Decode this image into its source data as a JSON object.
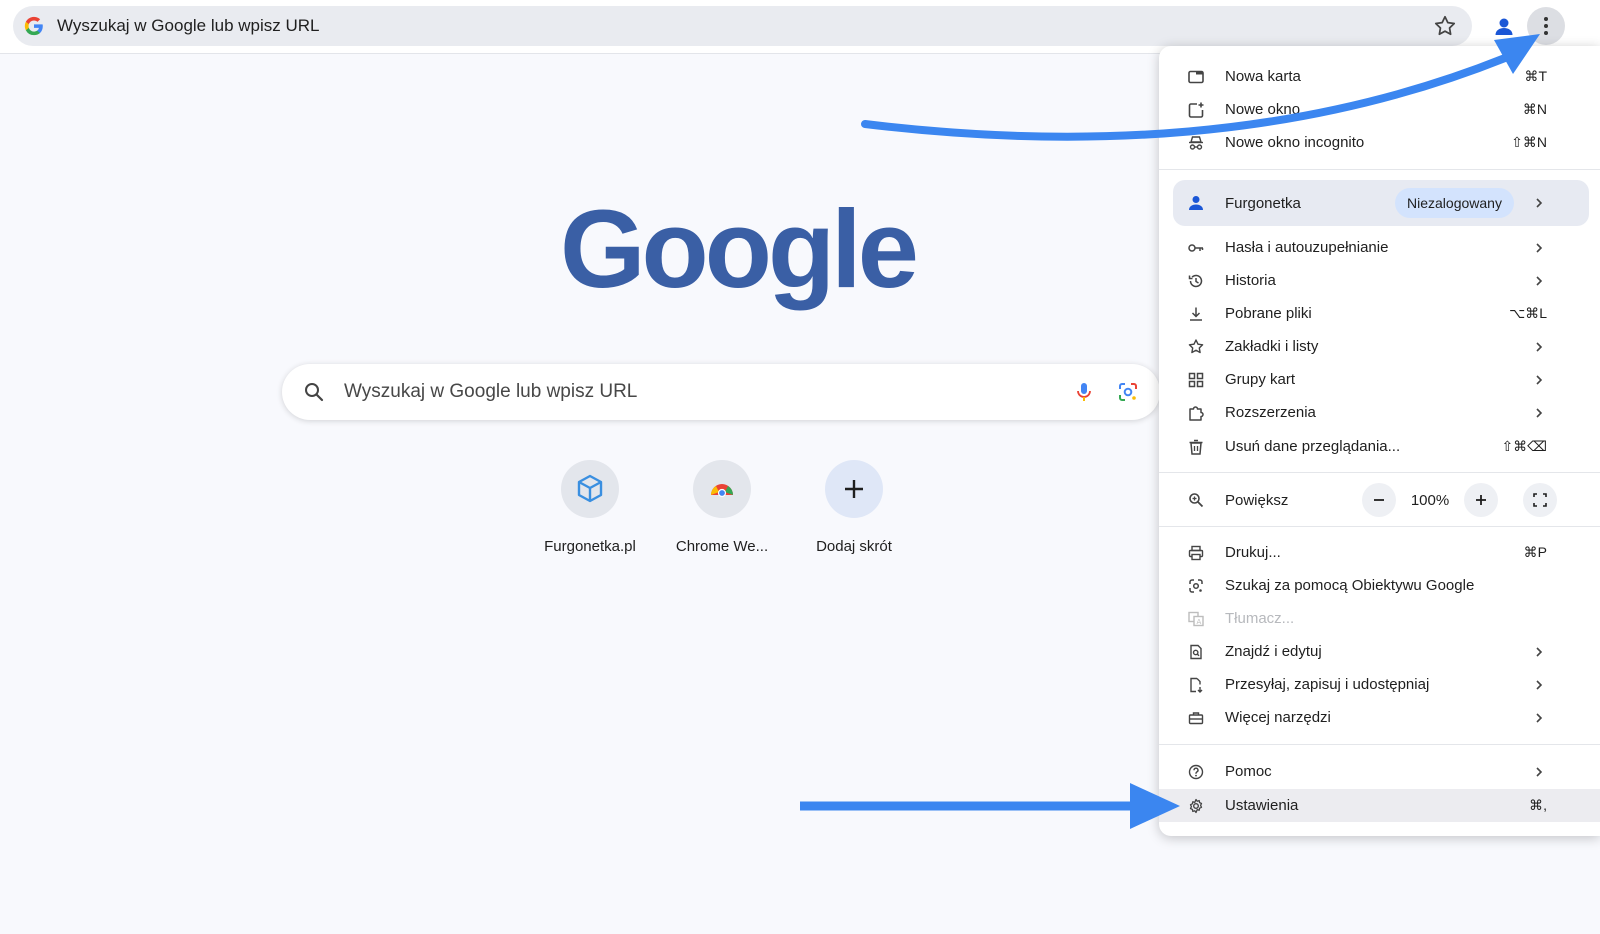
{
  "toolbar": {
    "omnibox_text": "Wyszukaj w Google lub wpisz URL"
  },
  "logo_text": "Google",
  "search": {
    "placeholder": "Wyszukaj w Google lub wpisz URL"
  },
  "shortcuts": [
    {
      "label": "Furgonetka.pl",
      "icon": "box-icon"
    },
    {
      "label": "Chrome We...",
      "icon": "chrome-icon"
    },
    {
      "label": "Dodaj skrót",
      "icon": "plus-icon"
    }
  ],
  "menu": {
    "new_tab": {
      "label": "Nowa karta",
      "shortcut": "⌘T"
    },
    "new_window": {
      "label": "Nowe okno",
      "shortcut": "⌘N"
    },
    "incognito": {
      "label": "Nowe okno incognito",
      "shortcut": "⇧⌘N"
    },
    "profile": {
      "label": "Furgonetka",
      "status": "Niezalogowany"
    },
    "passwords": {
      "label": "Hasła i autouzupełnianie"
    },
    "history": {
      "label": "Historia"
    },
    "downloads": {
      "label": "Pobrane pliki",
      "shortcut": "⌥⌘L"
    },
    "bookmarks": {
      "label": "Zakładki i listy"
    },
    "tab_groups": {
      "label": "Grupy kart"
    },
    "extensions": {
      "label": "Rozszerzenia"
    },
    "clear_data": {
      "label": "Usuń dane przeglądania...",
      "shortcut": "⇧⌘⌫"
    },
    "zoom": {
      "label": "Powiększ",
      "value": "100%",
      "minus": "−",
      "plus": "+"
    },
    "print": {
      "label": "Drukuj...",
      "shortcut": "⌘P"
    },
    "lens": {
      "label": "Szukaj za pomocą Obiektywu Google"
    },
    "translate": {
      "label": "Tłumacz..."
    },
    "find": {
      "label": "Znajdź i edytuj"
    },
    "cast": {
      "label": "Przesyłaj, zapisuj i udostępniaj"
    },
    "more_tools": {
      "label": "Więcej narzędzi"
    },
    "help": {
      "label": "Pomoc"
    },
    "settings": {
      "label": "Ustawienia",
      "shortcut": "⌘,"
    }
  },
  "colors": {
    "accent_arrow": "#3b86f0",
    "logo": "#3a5fa5",
    "chip": "#d3e3fd"
  }
}
